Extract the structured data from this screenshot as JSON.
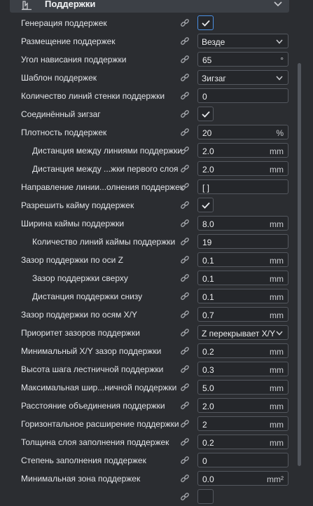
{
  "section": {
    "title": "Поддержки",
    "icon": "support-icon"
  },
  "rows": [
    {
      "label": "Генерация поддержек",
      "type": "check",
      "checked": true,
      "focus": true
    },
    {
      "label": "Размещение поддержек",
      "type": "select",
      "value": "Везде"
    },
    {
      "label": "Угол нависания поддержки",
      "type": "input",
      "value": "65",
      "unit": "°"
    },
    {
      "label": "Шаблон поддержек",
      "type": "select",
      "value": "Зигзаг"
    },
    {
      "label": "Количество линий стенки поддержки",
      "type": "input",
      "value": "0",
      "unit": ""
    },
    {
      "label": "Соединённый зигзаг",
      "type": "check",
      "checked": true
    },
    {
      "label": "Плотность поддержек",
      "type": "input",
      "value": "20",
      "unit": "%"
    },
    {
      "label": "Дистанция между линиями поддержки",
      "type": "input",
      "value": "2.0",
      "unit": "mm",
      "indent": true
    },
    {
      "label": "Дистанция между ...жки первого слоя",
      "type": "input",
      "value": "2.0",
      "unit": "mm",
      "indent": true
    },
    {
      "label": "Направление линии...олнения поддержек",
      "type": "input",
      "value": "[ ]",
      "unit": ""
    },
    {
      "label": "Разрешить кайму поддержек",
      "type": "check",
      "checked": true
    },
    {
      "label": "Ширина каймы поддержки",
      "type": "input",
      "value": "8.0",
      "unit": "mm"
    },
    {
      "label": "Количество линий каймы поддержки",
      "type": "input",
      "value": "19",
      "unit": "",
      "indent": true
    },
    {
      "label": "Зазор поддержки по оси Z",
      "type": "input",
      "value": "0.1",
      "unit": "mm"
    },
    {
      "label": "Зазор поддержки сверху",
      "type": "input",
      "value": "0.1",
      "unit": "mm",
      "indent": true
    },
    {
      "label": "Дистанция поддержки снизу",
      "type": "input",
      "value": "0.1",
      "unit": "mm",
      "indent": true
    },
    {
      "label": "Зазор поддержки по осям X/Y",
      "type": "input",
      "value": "0.7",
      "unit": "mm"
    },
    {
      "label": "Приоритет зазоров поддержки",
      "type": "select",
      "value": "Z перекрывает X/Y"
    },
    {
      "label": "Минимальный X/Y зазор поддержки",
      "type": "input",
      "value": "0.2",
      "unit": "mm"
    },
    {
      "label": "Высота шага лестничной поддержки",
      "type": "input",
      "value": "0.3",
      "unit": "mm"
    },
    {
      "label": "Максимальная шир...ничной поддержки",
      "type": "input",
      "value": "5.0",
      "unit": "mm"
    },
    {
      "label": "Расстояние объединения поддержки",
      "type": "input",
      "value": "2.0",
      "unit": "mm"
    },
    {
      "label": "Горизонтальное расширение поддержки",
      "type": "input",
      "value": "2",
      "unit": "mm"
    },
    {
      "label": "Толщина слоя заполнения поддержек",
      "type": "input",
      "value": "0.2",
      "unit": "mm"
    },
    {
      "label": "Степень заполнения поддержек",
      "type": "input",
      "value": "0",
      "unit": ""
    },
    {
      "label": "Минимальная зона поддержек",
      "type": "input",
      "value": "0.0",
      "unit": "mm²"
    },
    {
      "label": "",
      "type": "check",
      "checked": false
    }
  ],
  "icons": {
    "link": "link-icon",
    "chevron": "chevron-down-icon",
    "check": "check-icon"
  },
  "colors": {
    "background": "#2b2d31",
    "header": "#3c4046",
    "field_border": "#54585f",
    "focus": "#4b8fe2"
  }
}
